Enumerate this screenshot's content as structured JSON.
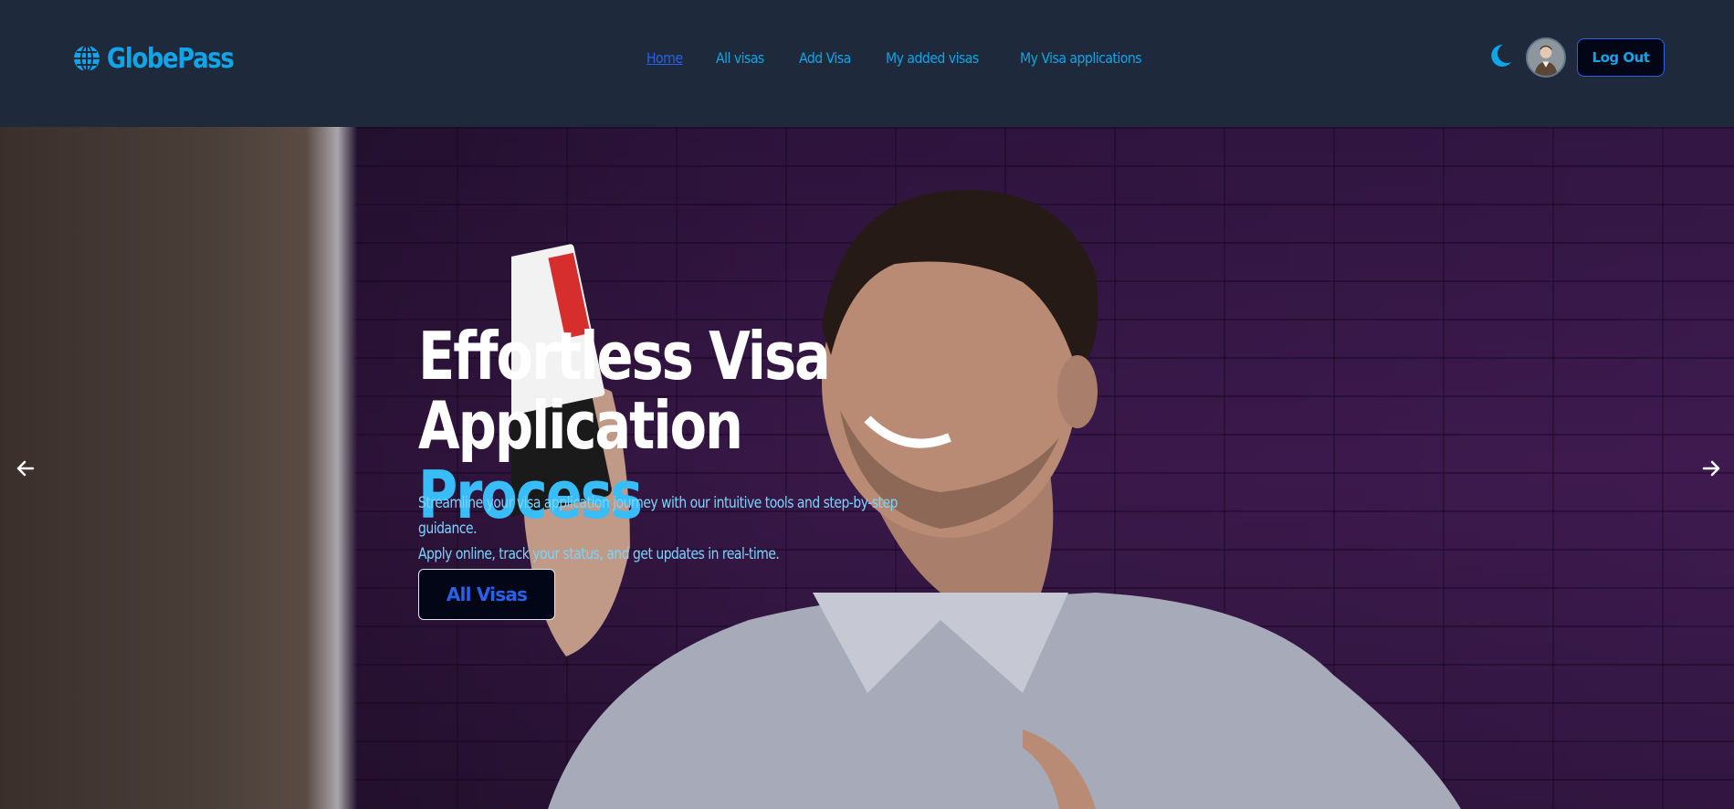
{
  "brand": {
    "name": "GlobePass",
    "icon": "globe-icon",
    "color": "#0ea5e9"
  },
  "nav": {
    "links": [
      {
        "label": "Home",
        "active": true
      },
      {
        "label": "All visas",
        "active": false
      },
      {
        "label": "Add Visa",
        "active": false
      },
      {
        "label": "My added visas",
        "active": false
      },
      {
        "label": "My Visa applications",
        "active": false
      }
    ],
    "theme_icon": "moon-icon",
    "avatar_icon": "user-avatar",
    "logout_label": "Log Out"
  },
  "hero": {
    "title_line1": "Effortless Visa",
    "title_line2_plain": "Application ",
    "title_line2_accent": "Process",
    "subtitle_line1": "Streamline your visa application journey with our intuitive tools and step-by-step guidance.",
    "subtitle_line2": "Apply online, track your status, and get updates in real-time.",
    "cta_label": "All Visas",
    "prev_icon": "arrow-left-icon",
    "next_icon": "arrow-right-icon",
    "accent_color": "#38bdf8"
  },
  "colors": {
    "navbar_bg": "#1e293b",
    "link": "#0ea5e9",
    "active_link": "#2563eb",
    "button_bg": "#020617"
  }
}
